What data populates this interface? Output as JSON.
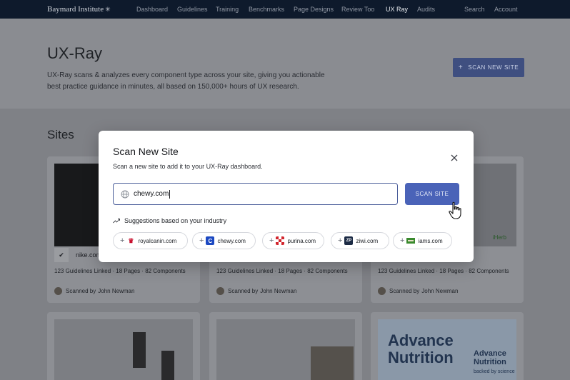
{
  "nav": {
    "logo": "Baymard Institute",
    "items": [
      "Dashboard",
      "Guidelines",
      "Training",
      "Benchmarks",
      "Page Designs",
      "Review Too",
      "UX Ray",
      "Audits",
      "Search",
      "Account"
    ]
  },
  "hero": {
    "title": "UX-Ray",
    "description": "UX-Ray scans & analyzes every component type across your site, giving you actionable best practice guidance in minutes, all based on 150,000+ hours of UX research.",
    "scan_button": "SCAN NEW SITE"
  },
  "sites": {
    "title": "Sites",
    "cards": [
      {
        "site": "nike.com",
        "meta": "123 Guidelines Linked · 18 Pages · 82 Components",
        "scanned_prefix": "Scanned by",
        "scanned_by": "John Newman"
      },
      {
        "site": "",
        "meta": "123 Guidelines Linked · 18 Pages · 82 Components",
        "scanned_prefix": "Scanned by",
        "scanned_by": "John Newman"
      },
      {
        "site": "",
        "meta": "123 Guidelines Linked · 18 Pages · 82 Components",
        "scanned_prefix": "Scanned by",
        "scanned_by": "John Newman"
      }
    ],
    "bottom_card_text": {
      "advance": "Advance",
      "nutrition": "Nutrition",
      "backed": "backed by science",
      "iherb": "iHerb"
    }
  },
  "modal": {
    "title": "Scan New Site",
    "subtitle": "Scan a new site to add it to your UX-Ray dashboard.",
    "input_value": "chewy.com",
    "scan_button": "SCAN SITE",
    "suggestions_title": "Suggestions based on your industry",
    "suggestions": [
      {
        "label": "royalcanin.com",
        "color": "#c8102e",
        "icon": "crown-logo"
      },
      {
        "label": "chewy.com",
        "color": "#1c49c2",
        "icon": "C"
      },
      {
        "label": "purina.com",
        "color": "#d2262e",
        "icon": "checker-logo"
      },
      {
        "label": "ziwi.com",
        "color": "#1b2a44",
        "icon": "ZP"
      },
      {
        "label": "iams.com",
        "color": "#3a8a2e",
        "icon": "bar-logo"
      }
    ]
  },
  "colors": {
    "accent": "#4a63b8",
    "nav_bg": "#0e1a2c"
  }
}
